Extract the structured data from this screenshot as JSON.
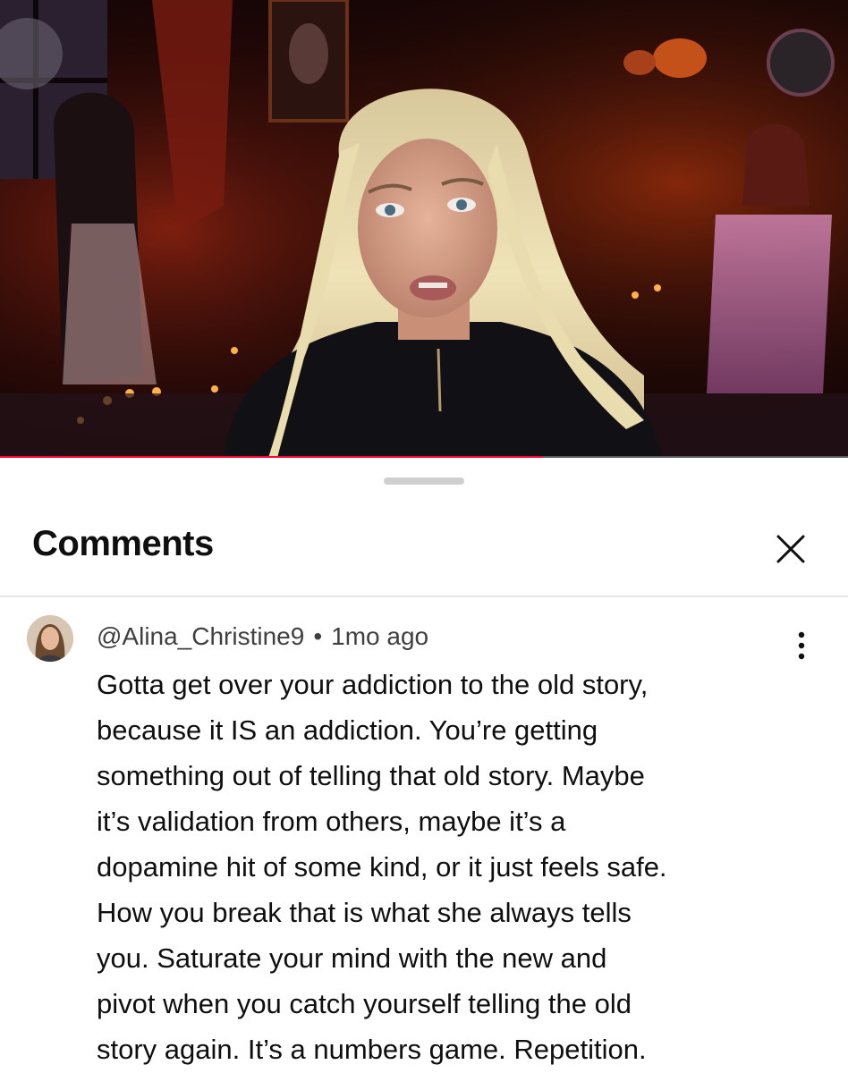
{
  "video": {
    "progress_fraction": 0.64
  },
  "sheet": {
    "title": "Comments"
  },
  "comment": {
    "author": "@Alina_Christine9",
    "separator": "•",
    "time_ago": "1mo ago",
    "lines": [
      "Gotta get over your addiction to the old story,",
      "because it IS an addiction. You’re getting",
      "something out of telling that old story. Maybe",
      "it’s validation from others, maybe it’s a",
      "dopamine hit of some kind, or it just feels safe.",
      "How you break that is what she always tells",
      "you. Saturate your mind with the new and",
      "pivot when you catch yourself telling the old",
      "story again. It’s a numbers game. Repetition."
    ]
  },
  "colors": {
    "progress": "#ff0033",
    "text": "#0f0f0f",
    "meta": "#3f3f3f"
  },
  "icons": {
    "close": "close-icon",
    "more": "more-vertical-icon"
  }
}
